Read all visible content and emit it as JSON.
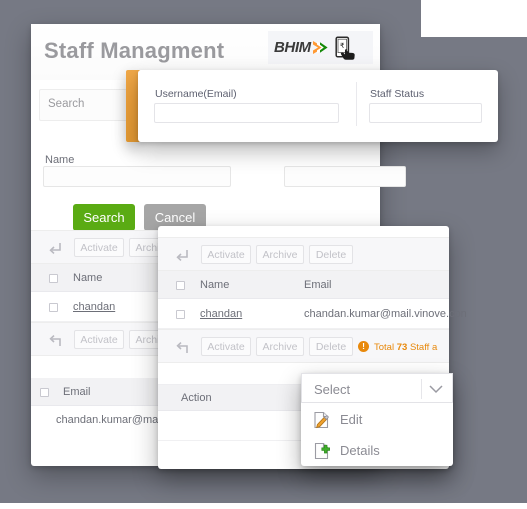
{
  "window": {
    "title": "Staff Managment",
    "brand": {
      "name": "BHIM",
      "arrow_icon": "tricolor-arrow-icon",
      "phone_icon": "phone-rupee-hand-icon",
      "colors": {
        "saffron": "#ff9933",
        "white": "#ffffff",
        "green": "#138808"
      }
    }
  },
  "search_bar": {
    "placeholder": "Search"
  },
  "filter_form": {
    "fields": [
      {
        "label": "Username(Email)",
        "value": ""
      },
      {
        "label": "Staff Status",
        "value": ""
      }
    ]
  },
  "main_form": {
    "name_label": "Name",
    "name_value": "",
    "second_value": "",
    "buttons": {
      "search": {
        "label": "Search",
        "color": "#5aab13"
      },
      "cancel": {
        "label": "Cancel",
        "color": "#a6a6a6"
      }
    }
  },
  "toolbar": {
    "actions": [
      "Activate",
      "Archive",
      "Delete"
    ],
    "collapse_icon": "arrow-turn-down-icon",
    "expand_icon": "arrow-turn-up-icon"
  },
  "table_back": {
    "columns": [
      "Name"
    ],
    "rows": [
      {
        "name": "chandan"
      }
    ],
    "email_header": "Email",
    "email_value": "chandan.kumar@mail.vino"
  },
  "table_front": {
    "columns": [
      "Name",
      "Email"
    ],
    "rows": [
      {
        "name": "chandan",
        "email": "chandan.kumar@mail.vinove.con"
      }
    ],
    "action_column": "Action",
    "status": {
      "icon": "alert-exclamation-icon",
      "prefix": "Total",
      "count": "73",
      "suffix": "Staff a",
      "color": "#e8890c"
    }
  },
  "dropdown": {
    "selected": "Select",
    "caret_icon": "chevron-down-icon",
    "options": [
      {
        "label": "Edit",
        "icon": "edit-pencil-icon"
      },
      {
        "label": "Details",
        "icon": "page-plus-icon"
      }
    ]
  },
  "theme": {
    "backdrop": "#767984",
    "accent_orange": "#eda03a",
    "title_grey": "#9a9a9e"
  }
}
